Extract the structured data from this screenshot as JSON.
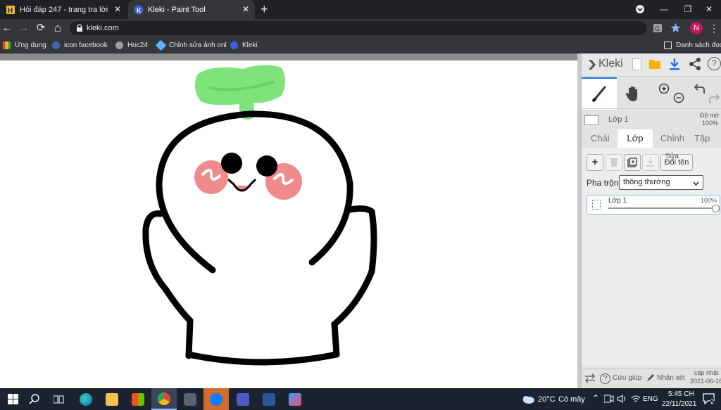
{
  "browser": {
    "tabs": [
      {
        "label": "Hỏi đáp 247 - trang tra lời",
        "favicon": "hoidap-icon",
        "active": false
      },
      {
        "label": "Kleki - Paint Tool",
        "favicon": "kleki-icon",
        "active": true
      }
    ],
    "new_tab": "+",
    "window_controls": {
      "minimize": "—",
      "restore": "❐",
      "close": "✕"
    },
    "nav": {
      "back": "←",
      "forward": "→",
      "reload": "⟳",
      "home": "⌂"
    },
    "url": "kleki.com",
    "profile_initial": "N",
    "bookmarks": [
      {
        "label": "Ứng dụng",
        "icon": "apps-grid-icon",
        "color": "#e8453c"
      },
      {
        "label": "icon facebook",
        "icon": "facebook-icon",
        "color": "#4267b2"
      },
      {
        "label": "Hoc24",
        "icon": "globe-icon",
        "color": "#9aa0a6"
      },
      {
        "label": "Chỉnh sửa ảnh onl",
        "icon": "photo-editor-icon",
        "color": "#5fb3ff"
      },
      {
        "label": "Kleki",
        "icon": "kleki-icon",
        "color": "#3c5dd6"
      }
    ],
    "reading_list": "Danh sách đọc"
  },
  "kleki": {
    "logo": "Kleki",
    "layer_header": {
      "name": "Lớp 1",
      "opacity_label": "Độ mờ",
      "opacity_value": "100%"
    },
    "tabs": [
      "Chải",
      "Lớp",
      "Chỉnh",
      "Tập tin"
    ],
    "active_tab": "Lớp",
    "layer_buttons": {
      "add": "+",
      "rename": "Đổi tên",
      "rename_overlay": "Sửa"
    },
    "blend": {
      "label": "Pha trộn",
      "value": "thông thường"
    },
    "layer_item": {
      "name": "Lớp 1",
      "opacity": "100%",
      "opacity_fraction": 1.0
    },
    "footer": {
      "help": "Cứu giúp",
      "feedback": "Nhận xét",
      "update_label": "cập nhật",
      "update_date": "2021-06-16"
    }
  },
  "taskbar": {
    "weather": {
      "temp": "20°C",
      "condition": "Có mây"
    },
    "language": "ENG",
    "time": "5:45 CH",
    "date": "22/11/2021",
    "notifications": "2"
  },
  "colors": {
    "accent_blue": "#1a73e8",
    "sprout_green": "#7ee37b",
    "blush_pink": "#f08b8b",
    "profile_pink": "#c2185b"
  }
}
